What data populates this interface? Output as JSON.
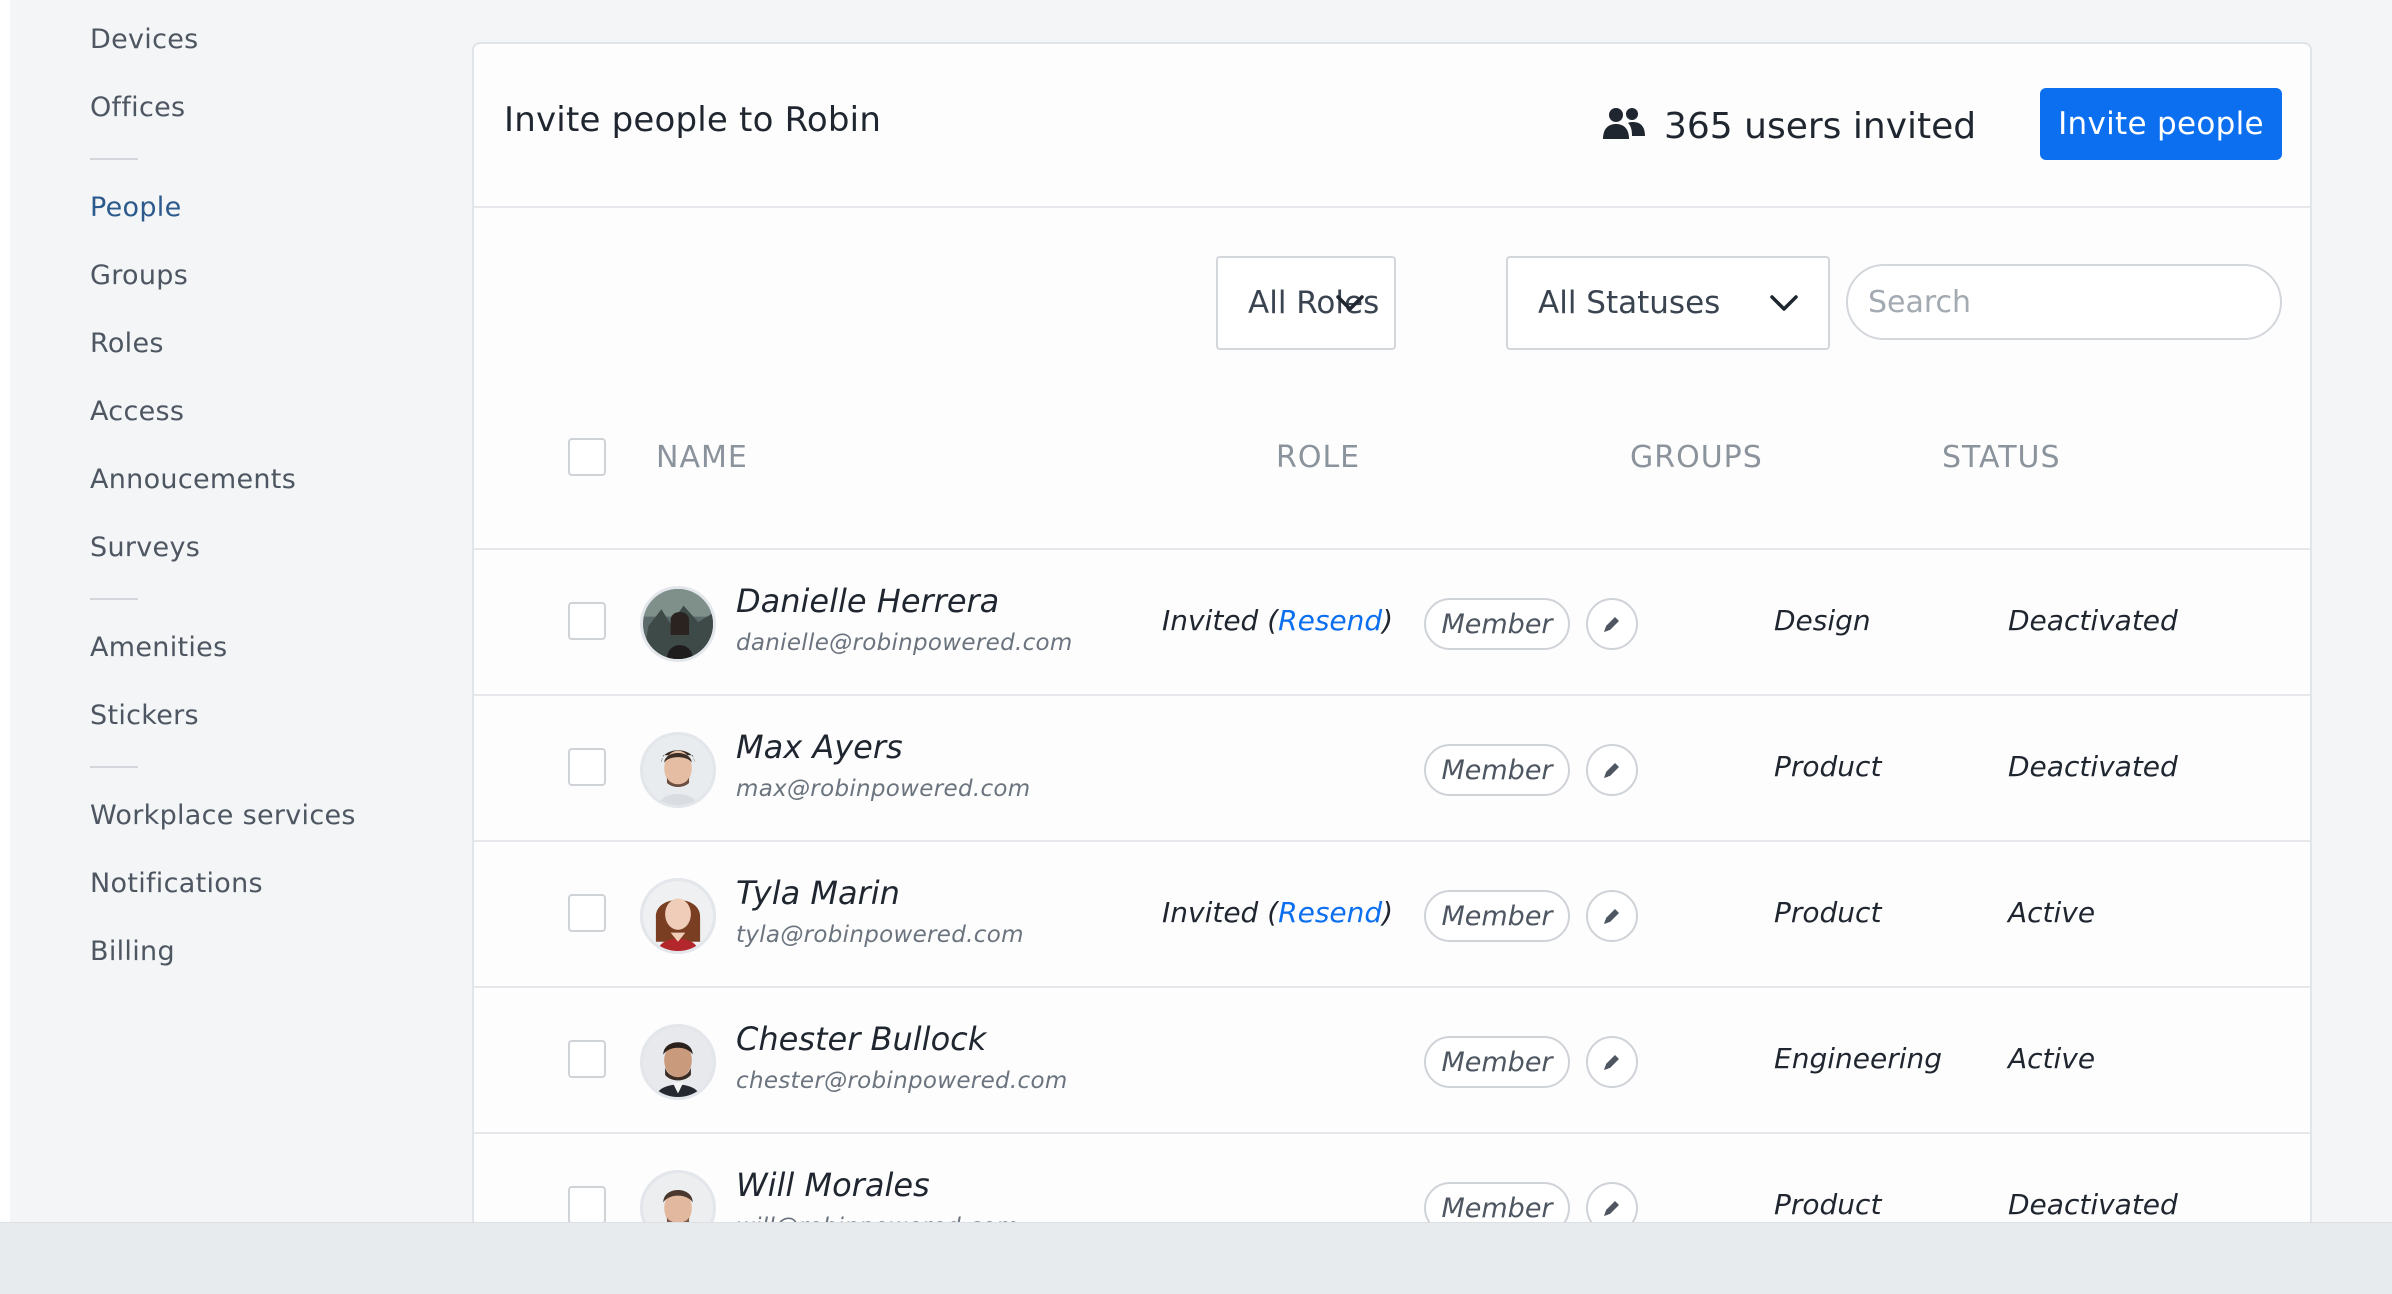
{
  "sidebar": {
    "items": [
      {
        "label": "Devices"
      },
      {
        "label": "Offices"
      },
      {
        "label": "People"
      },
      {
        "label": "Groups"
      },
      {
        "label": "Roles"
      },
      {
        "label": "Access"
      },
      {
        "label": "Annoucements"
      },
      {
        "label": "Surveys"
      },
      {
        "label": "Amenities"
      },
      {
        "label": "Stickers"
      },
      {
        "label": "Workplace services"
      },
      {
        "label": "Notifications"
      },
      {
        "label": "Billing"
      }
    ],
    "active": "People"
  },
  "header": {
    "title": "Invite people to Robin",
    "users_icon": "users-icon",
    "users_count": "365 users invited",
    "invite_label": "Invite people"
  },
  "filters": {
    "roles_label": "All Roles",
    "statuses_label": "All Statuses",
    "search_placeholder": "Search",
    "chevron_icon": "chevron-down-icon"
  },
  "table": {
    "columns": [
      "NAME",
      "ROLE",
      "GROUPS",
      "STATUS"
    ],
    "edit_icon": "pencil-icon",
    "rows": [
      {
        "name": "Danielle Herrera",
        "email": "danielle@robinpowered.com",
        "invited": "Invited (",
        "resend": "Resend",
        "invited_close": ")",
        "role": "Member",
        "group": "Design",
        "status": "Deactivated"
      },
      {
        "name": "Max Ayers",
        "email": "max@robinpowered.com",
        "invited": "",
        "resend": "",
        "invited_close": "",
        "role": "Member",
        "group": "Product",
        "status": "Deactivated"
      },
      {
        "name": "Tyla Marin",
        "email": "tyla@robinpowered.com",
        "invited": "Invited (",
        "resend": "Resend",
        "invited_close": ")",
        "role": "Member",
        "group": "Product",
        "status": "Active"
      },
      {
        "name": "Chester Bullock",
        "email": "chester@robinpowered.com",
        "invited": "",
        "resend": "",
        "invited_close": "",
        "role": "Member",
        "group": "Engineering",
        "status": "Active"
      },
      {
        "name": "Will Morales",
        "email": "will@robinpowered.com",
        "invited": "",
        "resend": "",
        "invited_close": "",
        "role": "Member",
        "group": "Product",
        "status": "Deactivated"
      }
    ]
  },
  "colors": {
    "accent": "#0b6ff0",
    "active_nav": "#2c5a8c"
  }
}
